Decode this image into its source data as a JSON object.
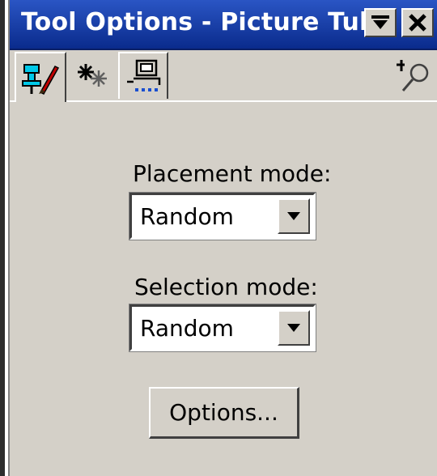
{
  "window": {
    "title": "Tool Options - Picture Tube"
  },
  "titlebar_buttons": {
    "rollup_icon": "rollup-icon",
    "close_icon": "close-icon"
  },
  "tabs": [
    {
      "icon": "brush-pin-icon",
      "active": true
    },
    {
      "icon": "sparkle-icon",
      "active": false
    },
    {
      "icon": "tablet-icon",
      "active": false
    }
  ],
  "pin_icon": "auto-hide-pin-icon",
  "placement": {
    "label": "Placement mode:",
    "value": "Random"
  },
  "selection": {
    "label": "Selection mode:",
    "value": "Random"
  },
  "options_button": {
    "label": "Options..."
  },
  "colors": {
    "title_bg": "#0a2b8c",
    "face": "#d4d0c8"
  }
}
